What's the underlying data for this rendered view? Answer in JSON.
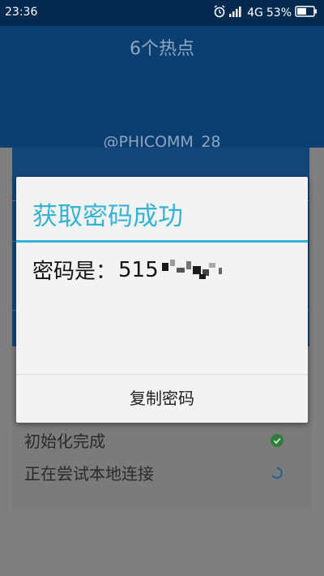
{
  "status_bar": {
    "time": "23:36",
    "network": "4G",
    "battery": "53%",
    "icons": [
      "alarm-icon",
      "signal-icon",
      "battery-icon"
    ]
  },
  "header": {
    "title": "6个热点",
    "ssid": "@PHICOMM_28"
  },
  "dialog": {
    "title": "获取密码成功",
    "message_label": "密码是：",
    "password_visible": "515",
    "copy_button": "复制密码"
  },
  "steps": [
    {
      "label": "初始化完成",
      "status": "done"
    },
    {
      "label": "正在尝试本地连接",
      "status": "loading"
    }
  ],
  "colors": {
    "accent": "#35b3d7",
    "status_bar": "#052a4f",
    "header": "#0b3f72",
    "check_green": "#2e9a3e"
  }
}
